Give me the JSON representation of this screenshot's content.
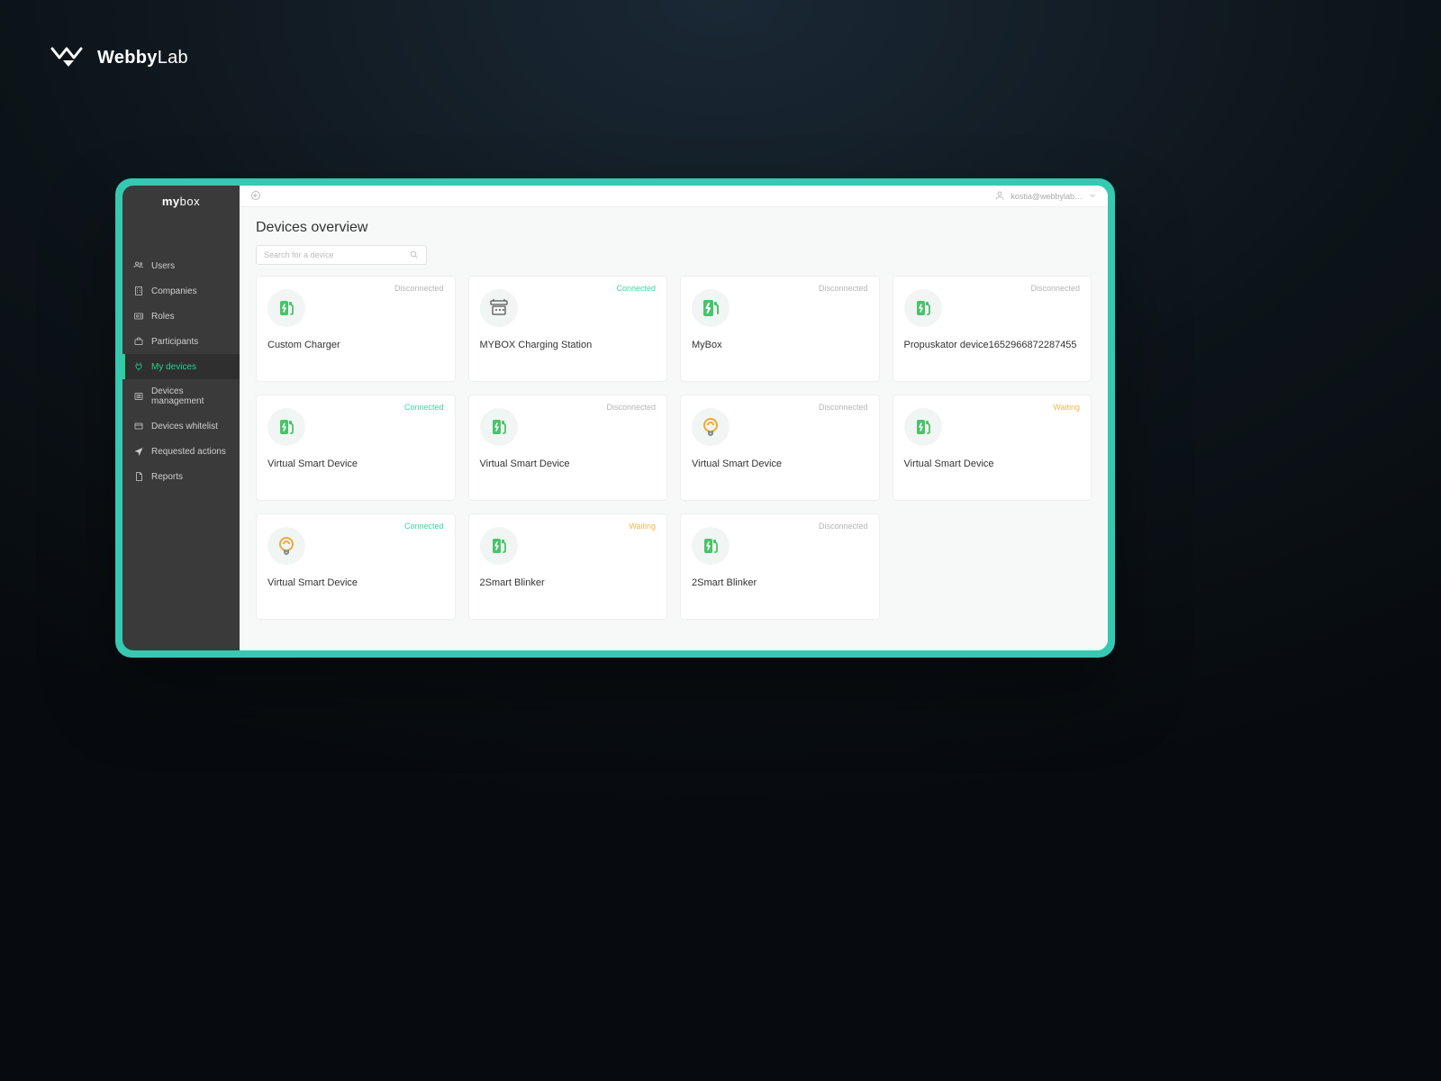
{
  "outer_brand": {
    "name_bold": "Webby",
    "name_light": "Lab"
  },
  "app": {
    "logo": {
      "main": "my",
      "accent": "box",
      "sub": ""
    },
    "topbar": {
      "user": "kostia@webbylab…"
    },
    "sidebar": {
      "items": [
        {
          "label": "Users",
          "icon": "users"
        },
        {
          "label": "Companies",
          "icon": "building"
        },
        {
          "label": "Roles",
          "icon": "id"
        },
        {
          "label": "Participants",
          "icon": "briefcase"
        },
        {
          "label": "My devices",
          "icon": "plug",
          "active": true
        },
        {
          "label": "Devices management",
          "icon": "list"
        },
        {
          "label": "Devices whitelist",
          "icon": "shield"
        },
        {
          "label": "Requested actions",
          "icon": "send"
        },
        {
          "label": "Reports",
          "icon": "file"
        }
      ]
    },
    "page": {
      "title": "Devices overview",
      "search_placeholder": "Search for a device"
    },
    "devices": [
      {
        "name": "Custom Charger",
        "status": "Disconnected",
        "status_class": "disconnected",
        "icon": "charger"
      },
      {
        "name": "MYBOX Charging Station",
        "status": "Connected",
        "status_class": "connected",
        "icon": "station"
      },
      {
        "name": "MyBox",
        "status": "Disconnected",
        "status_class": "disconnected",
        "icon": "charger-solid"
      },
      {
        "name": "Propuskator device1652966872287455",
        "status": "Disconnected",
        "status_class": "disconnected",
        "icon": "charger"
      },
      {
        "name": "Virtual Smart Device",
        "status": "Connected",
        "status_class": "connected",
        "icon": "charger"
      },
      {
        "name": "Virtual Smart Device",
        "status": "Disconnected",
        "status_class": "disconnected",
        "icon": "charger"
      },
      {
        "name": "Virtual Smart Device",
        "status": "Disconnected",
        "status_class": "disconnected",
        "icon": "bulb"
      },
      {
        "name": "Virtual Smart Device",
        "status": "Waiting",
        "status_class": "waiting",
        "icon": "charger"
      },
      {
        "name": "Virtual Smart Device",
        "status": "Connected",
        "status_class": "connected",
        "icon": "bulb"
      },
      {
        "name": "2Smart Blinker",
        "status": "Waiting",
        "status_class": "waiting",
        "icon": "charger"
      },
      {
        "name": "2Smart Blinker",
        "status": "Disconnected",
        "status_class": "disconnected",
        "icon": "charger"
      }
    ]
  }
}
